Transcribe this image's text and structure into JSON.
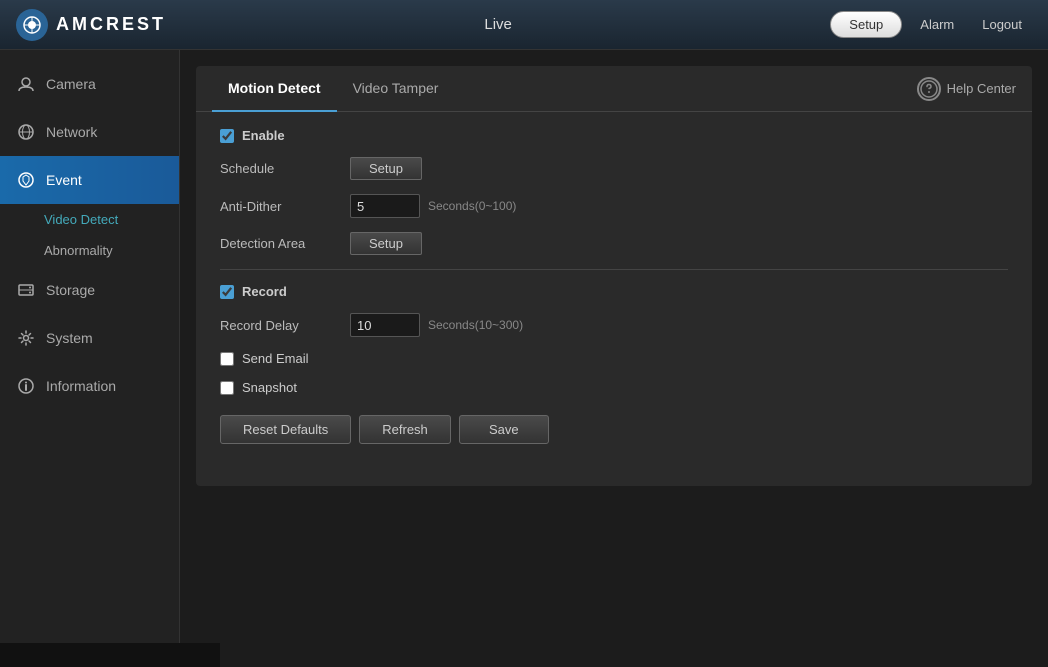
{
  "topbar": {
    "logo_text": "AMCREST",
    "live_label": "Live",
    "setup_label": "Setup",
    "alarm_label": "Alarm",
    "logout_label": "Logout"
  },
  "sidebar": {
    "items": [
      {
        "id": "camera",
        "label": "Camera",
        "icon": "👤"
      },
      {
        "id": "network",
        "label": "Network",
        "icon": "🌐"
      },
      {
        "id": "event",
        "label": "Event",
        "icon": "📡"
      },
      {
        "id": "storage",
        "label": "Storage",
        "icon": "💾"
      },
      {
        "id": "system",
        "label": "System",
        "icon": "⚙️"
      },
      {
        "id": "information",
        "label": "Information",
        "icon": "ℹ️"
      }
    ],
    "sub_items": [
      {
        "id": "video-detect",
        "label": "Video Detect"
      },
      {
        "id": "abnormality",
        "label": "Abnormality"
      }
    ]
  },
  "tabs": {
    "items": [
      {
        "id": "motion-detect",
        "label": "Motion Detect"
      },
      {
        "id": "video-tamper",
        "label": "Video Tamper"
      }
    ],
    "help_center_label": "Help Center"
  },
  "form": {
    "enable_label": "Enable",
    "enable_checked": true,
    "schedule_label": "Schedule",
    "schedule_btn": "Setup",
    "anti_dither_label": "Anti-Dither",
    "anti_dither_value": "5",
    "anti_dither_hint": "Seconds(0~100)",
    "detection_area_label": "Detection Area",
    "detection_area_btn": "Setup",
    "record_label": "Record",
    "record_checked": true,
    "record_delay_label": "Record Delay",
    "record_delay_value": "10",
    "record_delay_hint": "Seconds(10~300)",
    "send_email_label": "Send Email",
    "send_email_checked": false,
    "snapshot_label": "Snapshot",
    "snapshot_checked": false
  },
  "actions": {
    "reset_defaults_label": "Reset Defaults",
    "refresh_label": "Refresh",
    "save_label": "Save"
  }
}
